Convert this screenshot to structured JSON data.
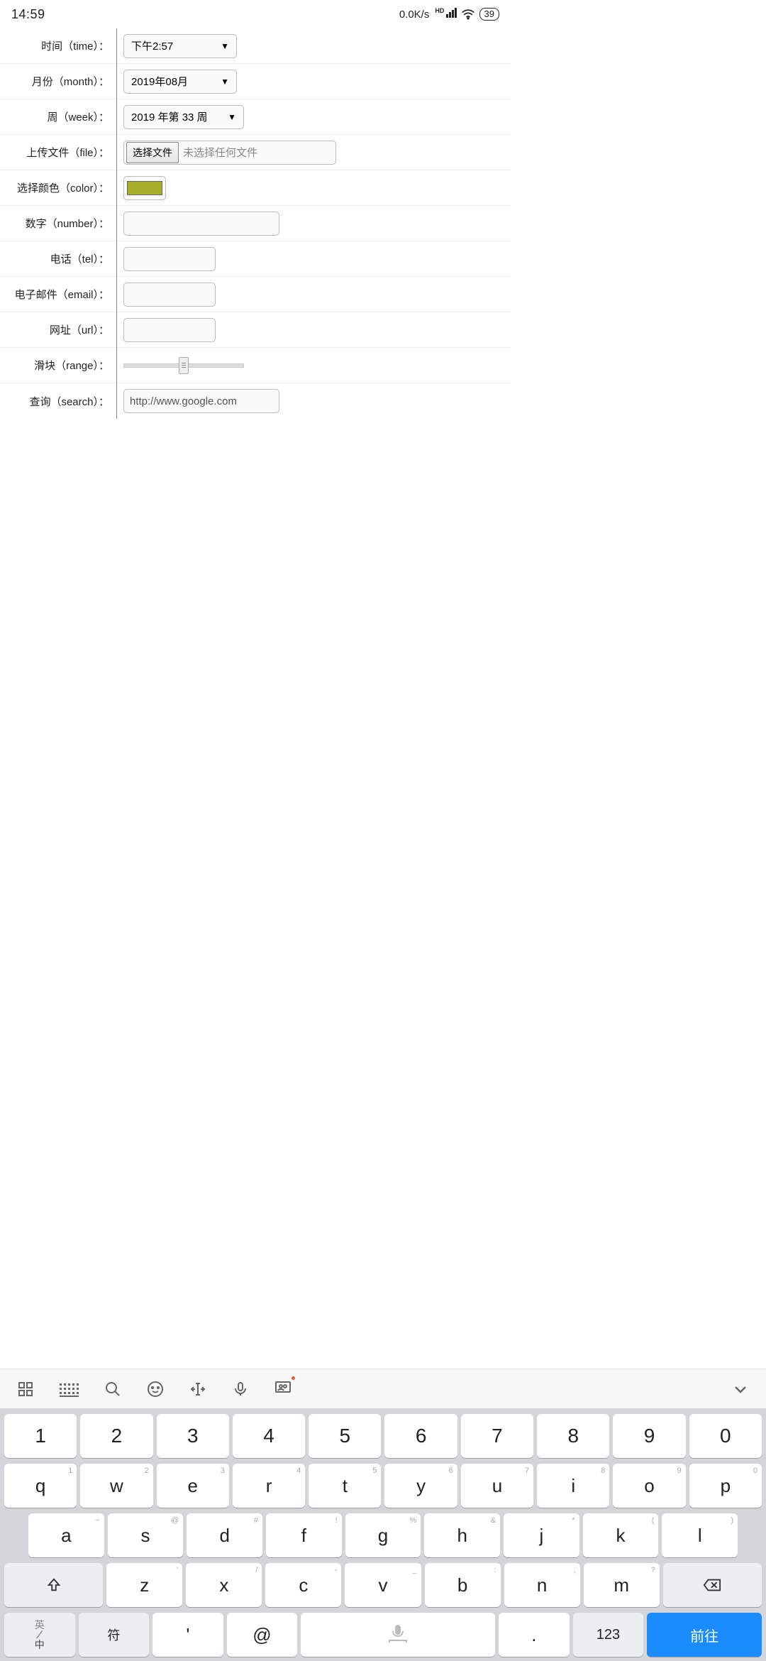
{
  "status": {
    "time": "14:59",
    "net_speed": "0.0K/s",
    "hd": "HD",
    "battery": "39"
  },
  "form": {
    "time": {
      "label": "时间（time）：",
      "value": "下午2:57"
    },
    "month": {
      "label": "月份（month）：",
      "value": "2019年08月"
    },
    "week": {
      "label": "周（week）：",
      "value": "2019 年第 33 周"
    },
    "file": {
      "label": "上传文件（file）：",
      "button": "选择文件",
      "placeholder": "未选择任何文件"
    },
    "color": {
      "label": "选择颜色（color）：",
      "value": "#a8ad2a"
    },
    "number": {
      "label": "数字（number）：",
      "value": ""
    },
    "tel": {
      "label": "电话（tel）：",
      "value": ""
    },
    "email": {
      "label": "电子邮件（email）：",
      "value": ""
    },
    "url": {
      "label": "网址（url）：",
      "value": ""
    },
    "range": {
      "label": "滑块（range）："
    },
    "search": {
      "label": "查询（search）：",
      "value": "http://www.google.com"
    }
  },
  "keyboard": {
    "row_num": [
      "1",
      "2",
      "3",
      "4",
      "5",
      "6",
      "7",
      "8",
      "9",
      "0"
    ],
    "row1": [
      {
        "k": "q",
        "s": "1"
      },
      {
        "k": "w",
        "s": "2"
      },
      {
        "k": "e",
        "s": "3"
      },
      {
        "k": "r",
        "s": "4"
      },
      {
        "k": "t",
        "s": "5"
      },
      {
        "k": "y",
        "s": "6"
      },
      {
        "k": "u",
        "s": "7"
      },
      {
        "k": "i",
        "s": "8"
      },
      {
        "k": "o",
        "s": "9"
      },
      {
        "k": "p",
        "s": "0"
      }
    ],
    "row2": [
      {
        "k": "a",
        "s": "~"
      },
      {
        "k": "s",
        "s": "@"
      },
      {
        "k": "d",
        "s": "#"
      },
      {
        "k": "f",
        "s": "!"
      },
      {
        "k": "g",
        "s": "%"
      },
      {
        "k": "h",
        "s": "&"
      },
      {
        "k": "j",
        "s": "*"
      },
      {
        "k": "k",
        "s": "("
      },
      {
        "k": "l",
        "s": ")"
      }
    ],
    "row3": [
      {
        "k": "z",
        "s": "'"
      },
      {
        "k": "x",
        "s": "/"
      },
      {
        "k": "c",
        "s": "-"
      },
      {
        "k": "v",
        "s": "_"
      },
      {
        "k": "b",
        "s": ":"
      },
      {
        "k": "n",
        "s": ";"
      },
      {
        "k": "m",
        "s": "?"
      }
    ],
    "bottom": {
      "lang_en": "英",
      "lang_zh": "中",
      "symbol": "符",
      "apostrophe": "'",
      "at": "@",
      "dot": ".",
      "num": "123",
      "go": "前往"
    }
  }
}
